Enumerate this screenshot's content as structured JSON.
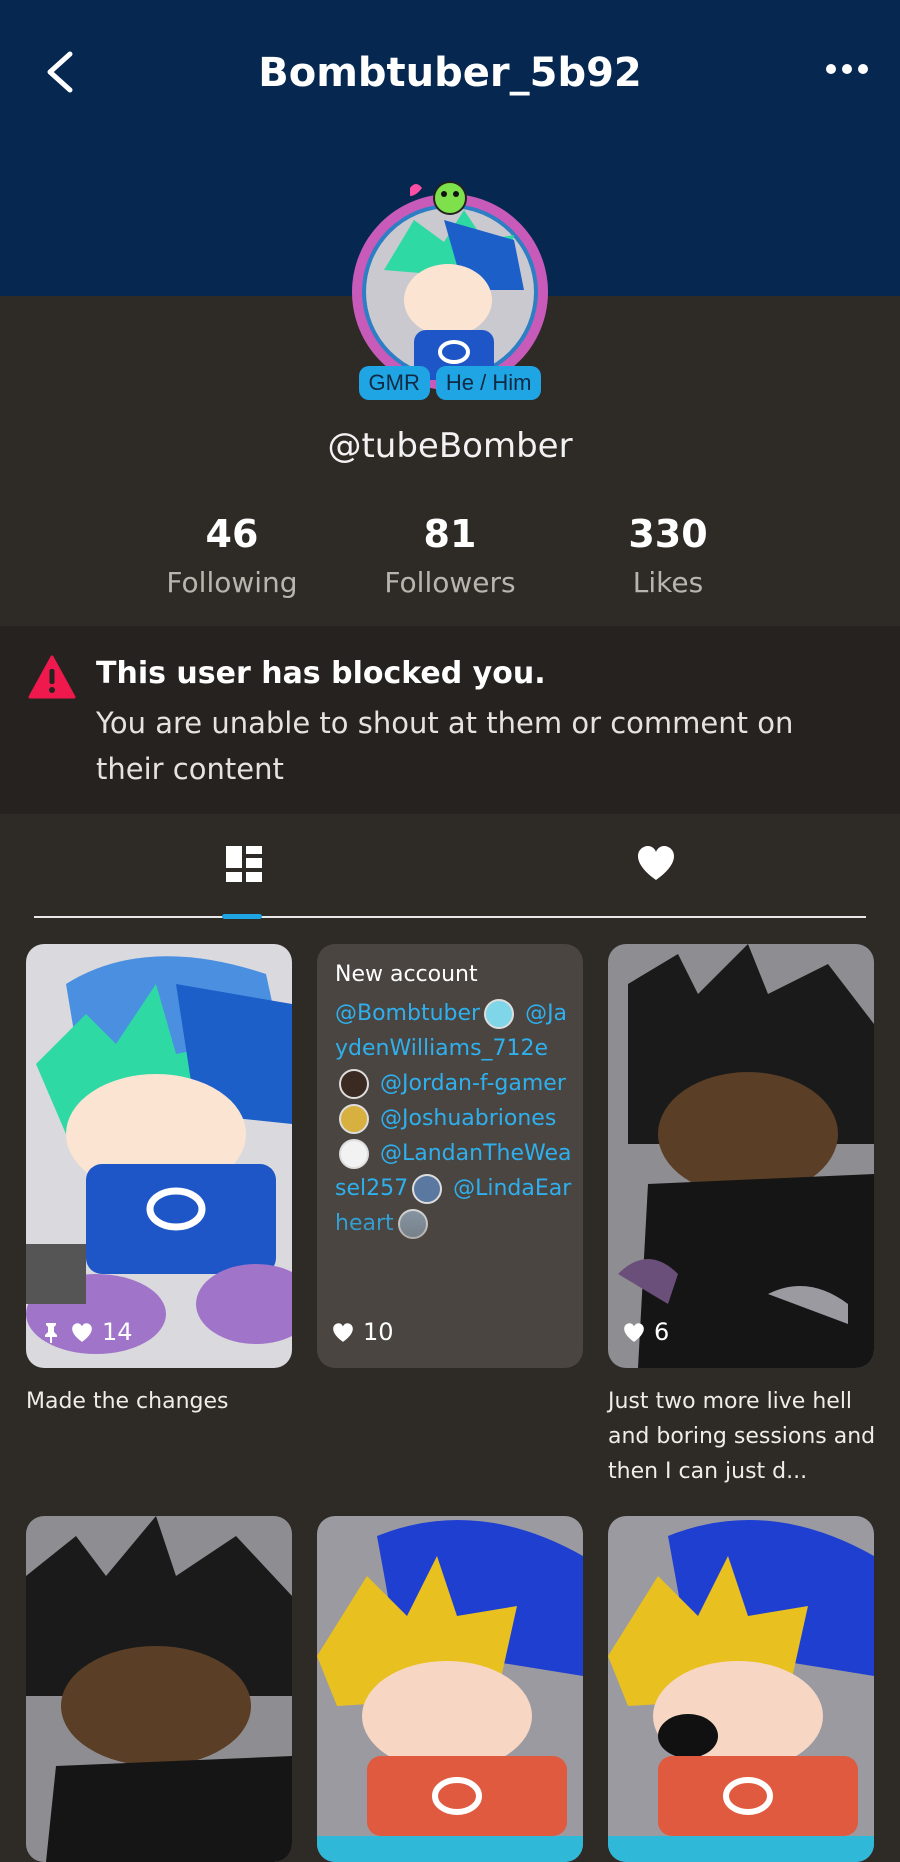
{
  "header": {
    "title": "Bombtuber_5b92"
  },
  "profile": {
    "badges": [
      "GMR",
      "He / Him"
    ],
    "handle": "@tubeBomber"
  },
  "stats": [
    {
      "value": "46",
      "label": "Following"
    },
    {
      "value": "81",
      "label": "Followers"
    },
    {
      "value": "330",
      "label": "Likes"
    }
  ],
  "blocked": {
    "title": "This user has blocked you.",
    "message": "You are unable to shout at them or comment on their content"
  },
  "tabs": [
    {
      "icon": "grid-icon",
      "active": true
    },
    {
      "icon": "heart-icon",
      "active": false
    }
  ],
  "posts": [
    {
      "likes": "14",
      "pinned": true,
      "caption": "Made the changes"
    },
    {
      "likes": "10",
      "caption": "",
      "text_header": "New account",
      "mentions": [
        "@Bombtuber",
        "@JaydenWilliams_712e",
        "@Jordan-f-gamer",
        "@Joshuabriones",
        "@LandanTheWeasel257",
        "@LindaEarheart"
      ]
    },
    {
      "likes": "6",
      "caption": "Just two more live hell and boring sessions and then I can just d..."
    }
  ],
  "colors": {
    "header_bg": "#052750",
    "page_bg": "#2e2a26",
    "accent": "#1fa5e4",
    "warning": "#f0194e"
  }
}
